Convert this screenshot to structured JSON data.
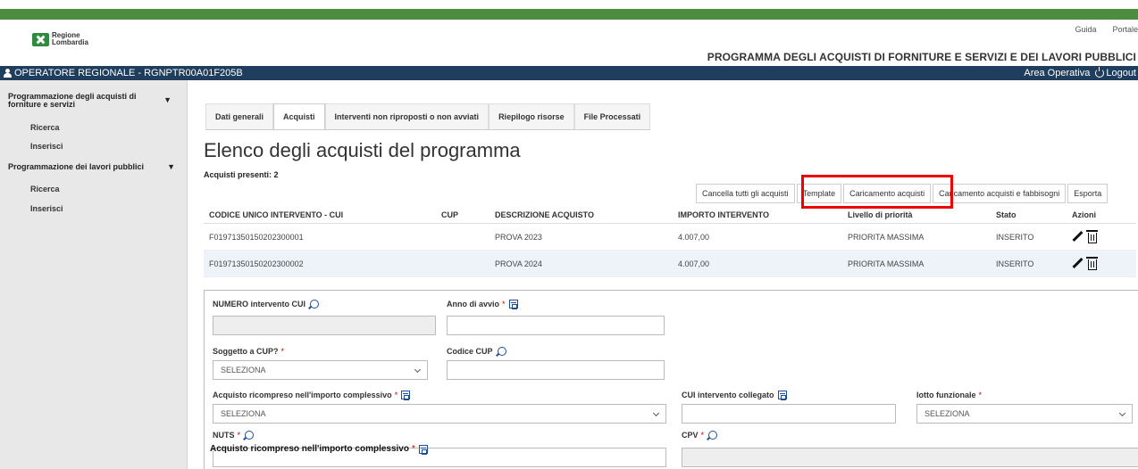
{
  "header": {
    "logo_text": "Regione\nLombardia",
    "links": [
      "Guida",
      "Portale"
    ],
    "program_title": "PROGRAMMA DEGLI ACQUISTI DI FORNITURE E SERVIZI E DEI LAVORI PUBBLICI"
  },
  "userbar": {
    "user_label": "OPERATORE REGIONALE - RGNPTR00A01F205B",
    "area": "Area Operativa",
    "logout": "Logout"
  },
  "sidebar": {
    "section1": "Programmazione degli acquisti di forniture e servizi",
    "section1_items": [
      "Ricerca",
      "Inserisci"
    ],
    "section2": "Programmazione dei lavori pubblici",
    "section2_items": [
      "Ricerca",
      "Inserisci"
    ]
  },
  "tabs": [
    "Dati generali",
    "Acquisti",
    "Interventi non riproposti o non avviati",
    "Riepilogo risorse",
    "File Processati"
  ],
  "active_tab": "Acquisti",
  "main": {
    "title": "Elenco degli acquisti del programma",
    "count_label": "Acquisti presenti: 2"
  },
  "buttons": [
    "Cancella tutti gli acquisti",
    "Template",
    "Caricamento acquisti",
    "Caricamento acquisti e fabbisogni",
    "Esporta"
  ],
  "table": {
    "headers": [
      "CODICE UNICO INTERVENTO - CUI",
      "CUP",
      "DESCRIZIONE ACQUISTO",
      "IMPORTO INTERVENTO",
      "Livello di priorità",
      "Stato",
      "Azioni"
    ],
    "rows": [
      [
        "F01971350150202300001",
        "",
        "PROVA 2023",
        "4.007,00",
        "PRIORITA MASSIMA",
        "INSERITO"
      ],
      [
        "F01971350150202300002",
        "",
        "PROVA 2024",
        "4.007,00",
        "PRIORITA MASSIMA",
        "INSERITO"
      ]
    ]
  },
  "form": {
    "numero_cui_label": "NUMERO intervento CUI",
    "anno_avvio_label": "Anno di avvio",
    "soggetto_cup_label": "Soggetto a CUP?",
    "soggetto_cup_value": "SELEZIONA",
    "codice_cup_label": "Codice CUP",
    "acquisto_ricompreso_label": "Acquisto ricompreso nell'importo complessivo",
    "acquisto_ricompreso_value": "SELEZIONA",
    "cui_collegato_label": "CUI intervento collegato",
    "lotto_label": "lotto funzionale",
    "lotto_value": "SELEZIONA",
    "nuts_label": "NUTS",
    "cpv_label": "CPV",
    "overlay_label": "Acquisto ricompreso nell'importo complessivo",
    "required_mark": "*"
  },
  "colors": {
    "green_bar": "#4c8c3f",
    "user_bar": "#1f3d5c",
    "highlight": "#e00000"
  }
}
